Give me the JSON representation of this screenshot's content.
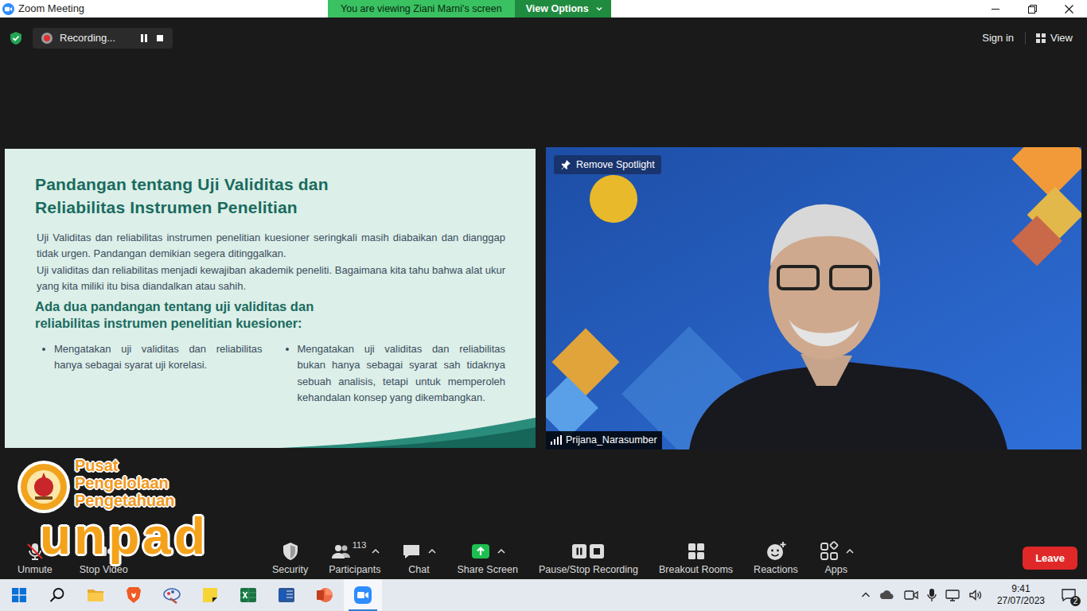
{
  "window": {
    "title": "Zoom Meeting"
  },
  "banner": {
    "text": "You are viewing Ziani Marni's screen",
    "options": "View Options"
  },
  "recording": {
    "label": "Recording..."
  },
  "top_right": {
    "sign_in": "Sign in",
    "view": "View"
  },
  "slide": {
    "title": "Pandangan tentang Uji Validitas dan Reliabilitas Instrumen Penelitian",
    "paragraphs": [
      "Uji Validitas dan reliabilitas instrumen penelitian kuesioner seringkali masih diabaikan dan dianggap tidak urgen. Pandangan demikian segera ditinggalkan.",
      "Uji validitas dan reliabilitas menjadi kewajiban akademik peneliti. Bagaimana kita tahu bahwa alat ukur yang kita miliki itu bisa diandalkan atau sahih."
    ],
    "subtitle": "Ada dua pandangan tentang uji validitas dan reliabilitas instrumen penelitian kuesioner:",
    "bullets": [
      "Mengatakan uji validitas dan reliabilitas hanya sebagai syarat uji korelasi.",
      "Mengatakan uji validitas dan reliabilitas bukan hanya sebagai syarat sah tidaknya sebuah analisis, tetapi untuk memperoleh kehandalan konsep yang dikembangkan."
    ]
  },
  "video": {
    "spotlight": "Remove Spotlight",
    "participant": "Prijana_Narasumber"
  },
  "logo": {
    "lines": [
      "Pusat",
      "Pengelolaan",
      "Pengetahuan"
    ],
    "word": "unpad"
  },
  "toolbar": {
    "items": [
      {
        "label": "Unmute",
        "kind": "mic-off",
        "caret": false
      },
      {
        "label": "Stop Video",
        "kind": "video",
        "caret": false
      },
      {
        "label": "Security",
        "kind": "security",
        "caret": false
      },
      {
        "label": "Participants",
        "kind": "participants",
        "count": "113",
        "caret": true
      },
      {
        "label": "Chat",
        "kind": "chat",
        "caret": true
      },
      {
        "label": "Share Screen",
        "kind": "share",
        "caret": true
      },
      {
        "label": "Pause/Stop Recording",
        "kind": "recording",
        "caret": false
      },
      {
        "label": "Breakout Rooms",
        "kind": "breakout",
        "caret": false
      },
      {
        "label": "Reactions",
        "kind": "reactions",
        "caret": false
      },
      {
        "label": "Apps",
        "kind": "apps",
        "caret": true
      }
    ],
    "leave": "Leave"
  },
  "taskbar": {
    "apps": [
      {
        "kind": "explorer",
        "active": false
      },
      {
        "kind": "brave",
        "active": false
      },
      {
        "kind": "paint",
        "active": false
      },
      {
        "kind": "sticky",
        "active": false
      },
      {
        "kind": "excel",
        "active": false
      },
      {
        "kind": "word",
        "active": false
      },
      {
        "kind": "powerpoint",
        "active": false
      },
      {
        "kind": "zoom",
        "active": true
      }
    ],
    "time": "9:41",
    "date": "27/07/2023",
    "notifications": "2"
  }
}
